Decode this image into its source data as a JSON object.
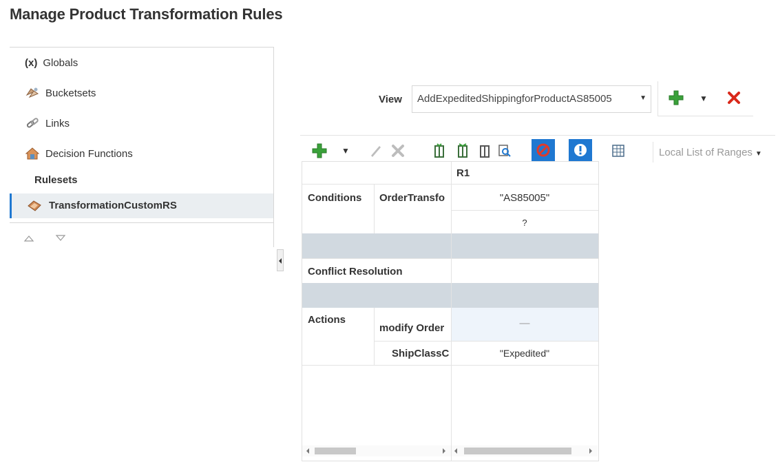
{
  "page": {
    "title": "Manage Product Transformation Rules"
  },
  "navigator": {
    "items": [
      {
        "label": "Globals",
        "icon": "globals-x-icon"
      },
      {
        "label": "Bucketsets",
        "icon": "bucketsets-icon"
      },
      {
        "label": "Links",
        "icon": "links-icon"
      },
      {
        "label": "Decision Functions",
        "icon": "decision-functions-icon"
      }
    ],
    "globals_prefix": "(x)",
    "rulesets_heading": "Rulesets",
    "selected_ruleset": "TransformationCustomRS",
    "move_up": "move-up-icon",
    "move_down": "move-down-icon"
  },
  "view": {
    "label": "View",
    "selected": "AddExpeditedShippingforProductAS85005",
    "add_icon": "add-icon",
    "menu_icon": "chevron-down-icon",
    "delete_icon": "delete-icon"
  },
  "toolbar": {
    "icons": [
      "add-icon",
      "chevron-down-icon",
      "edit-icon",
      "delete-icon",
      "split-cells-icon",
      "merge-cells-icon",
      "find-icon",
      "disable-icon",
      "validate-icon",
      "gap-analysis-icon"
    ],
    "ranges_select": "Local List of Ranges"
  },
  "decision_table": {
    "rule_header": "R1",
    "conditions_label": "Conditions",
    "condition_name": "OrderTransfo",
    "condition_value_1": "\"AS85005\"",
    "condition_value_2": "?",
    "conflict_label": "Conflict Resolution",
    "actions_label": "Actions",
    "action_name": "modify Order",
    "action_value": "—",
    "attribute_name": "ShipClassC",
    "attribute_value": "\"Expedited\""
  },
  "colors": {
    "accent": "#1f78d1",
    "band": "#d1d9e0",
    "add_green": "#3aa13a",
    "delete_red": "#d9281a"
  }
}
